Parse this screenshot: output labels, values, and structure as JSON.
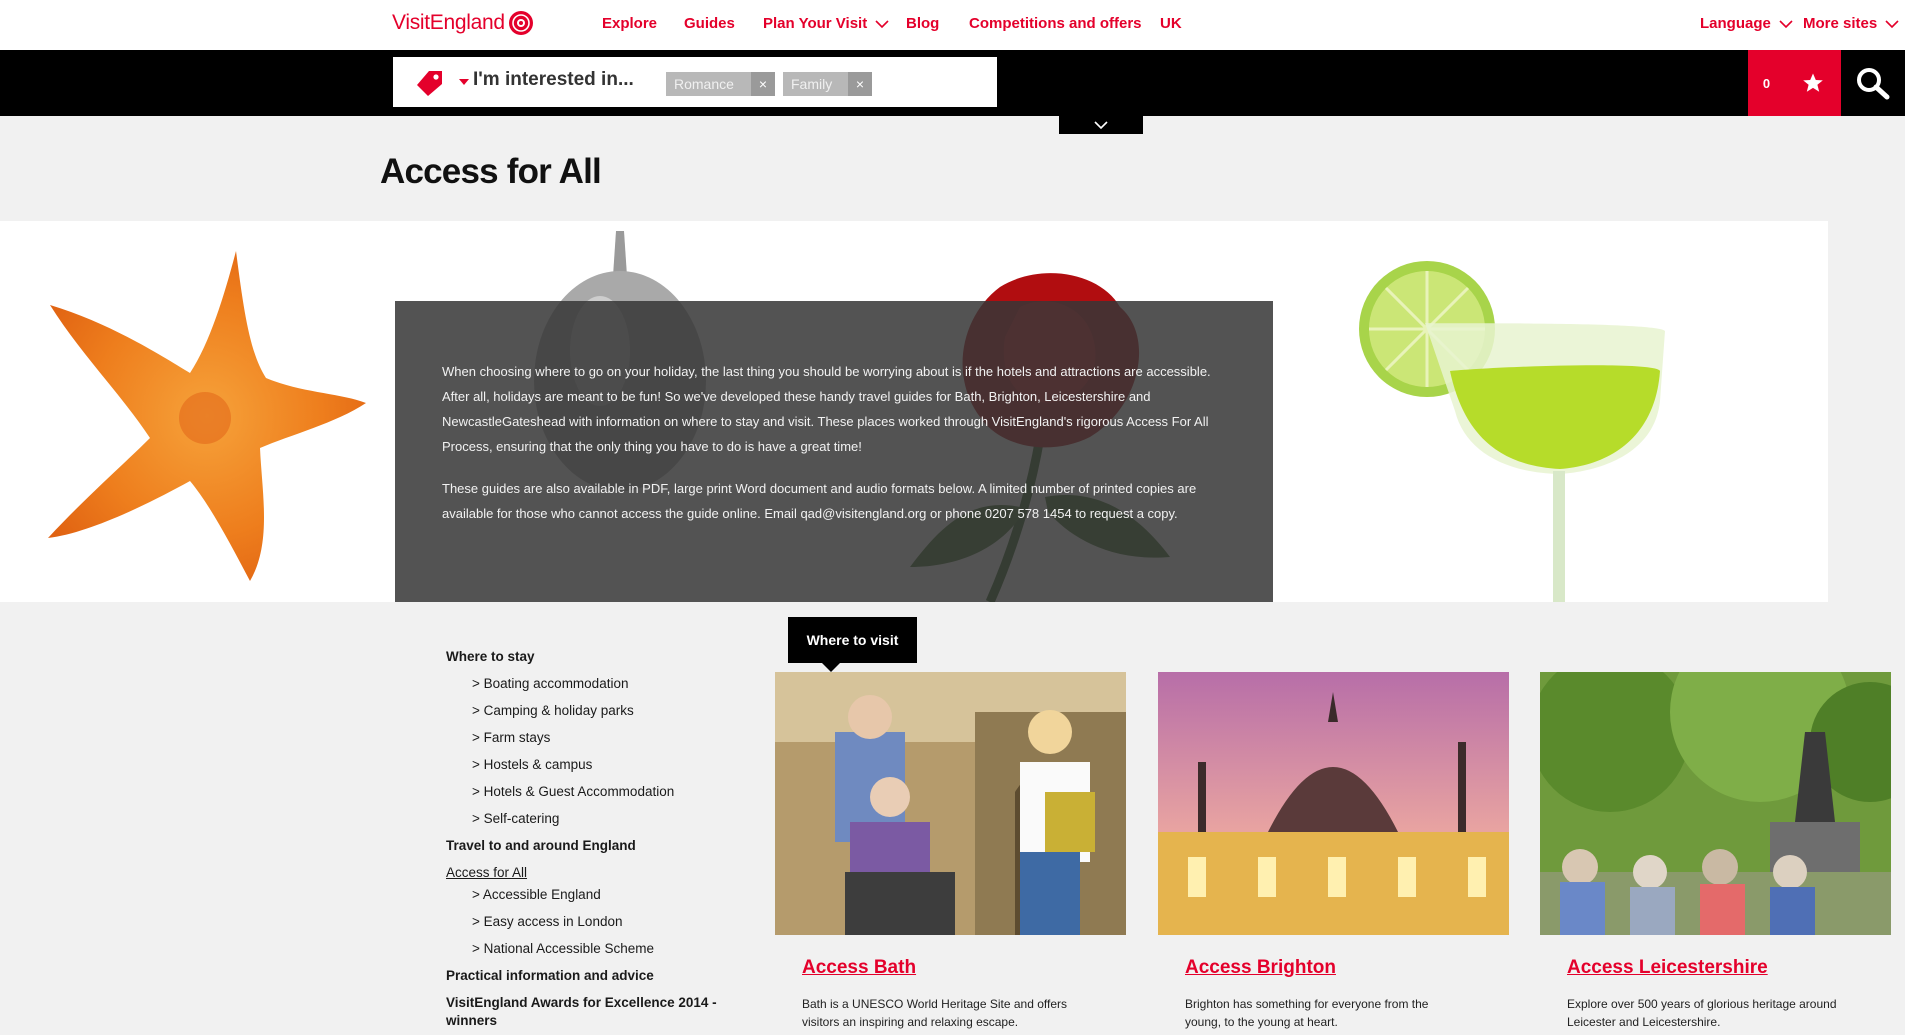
{
  "brand": {
    "name": "VisitEngland"
  },
  "nav": {
    "items": [
      {
        "label": "Explore"
      },
      {
        "label": "Guides"
      },
      {
        "label": "Plan Your Visit"
      },
      {
        "label": "Blog"
      },
      {
        "label": "Competitions and offers"
      },
      {
        "label": "UK"
      }
    ],
    "language": "Language",
    "more_sites": "More sites"
  },
  "search": {
    "label": "I'm interested in...",
    "chips": [
      {
        "label": "Romance"
      },
      {
        "label": "Family"
      }
    ],
    "chip_close": "×",
    "favourites_count": "0"
  },
  "page": {
    "title": "Access for All"
  },
  "intro": {
    "p1": "When choosing where to go on your holiday, the last thing you should be worrying about is if the hotels and attractions are accessible. After all, holidays are meant to be fun! So we've developed these handy travel guides for Bath, Brighton, Leicestershire and NewcastleGateshead with information on where to stay and visit.  These places worked through VisitEngland's rigorous Access For All Process, ensuring that the only thing you have to do is have a great time!",
    "p2": "These guides are also available in PDF, large print Word document and audio formats below. A limited number of printed copies are available for those who cannot access the guide online. Email qad@visitengland.org or phone 0207 578 1454 to request a copy."
  },
  "sidebar": {
    "where_to_stay": "Where to stay",
    "stay_items": [
      "> Boating accommodation",
      "> Camping & holiday parks",
      "> Farm stays",
      "> Hostels & campus",
      "> Hotels & Guest Accommodation",
      "> Self-catering"
    ],
    "travel": "Travel to and around England",
    "access_for_all": "Access for All",
    "access_items": [
      "> Accessible England",
      "> Easy access in London",
      "> National Accessible Scheme"
    ],
    "practical": "Practical information and advice",
    "awards": "VisitEngland Awards for Excellence 2014 - winners"
  },
  "where_to_visit": {
    "tab": "Where to visit",
    "cards": [
      {
        "title": "Access Bath",
        "desc": "Bath is a UNESCO World Heritage Site and offers visitors an inspiring and relaxing escape."
      },
      {
        "title": "Access Brighton",
        "desc": "Brighton has something for everyone from the young, to the young at heart."
      },
      {
        "title": "Access Leicestershire",
        "desc": "Explore over 500 years of glorious heritage around Leicester and Leicestershire."
      }
    ]
  },
  "colors": {
    "brand_red": "#e4002b",
    "black": "#000000",
    "overlay": "#373737"
  }
}
